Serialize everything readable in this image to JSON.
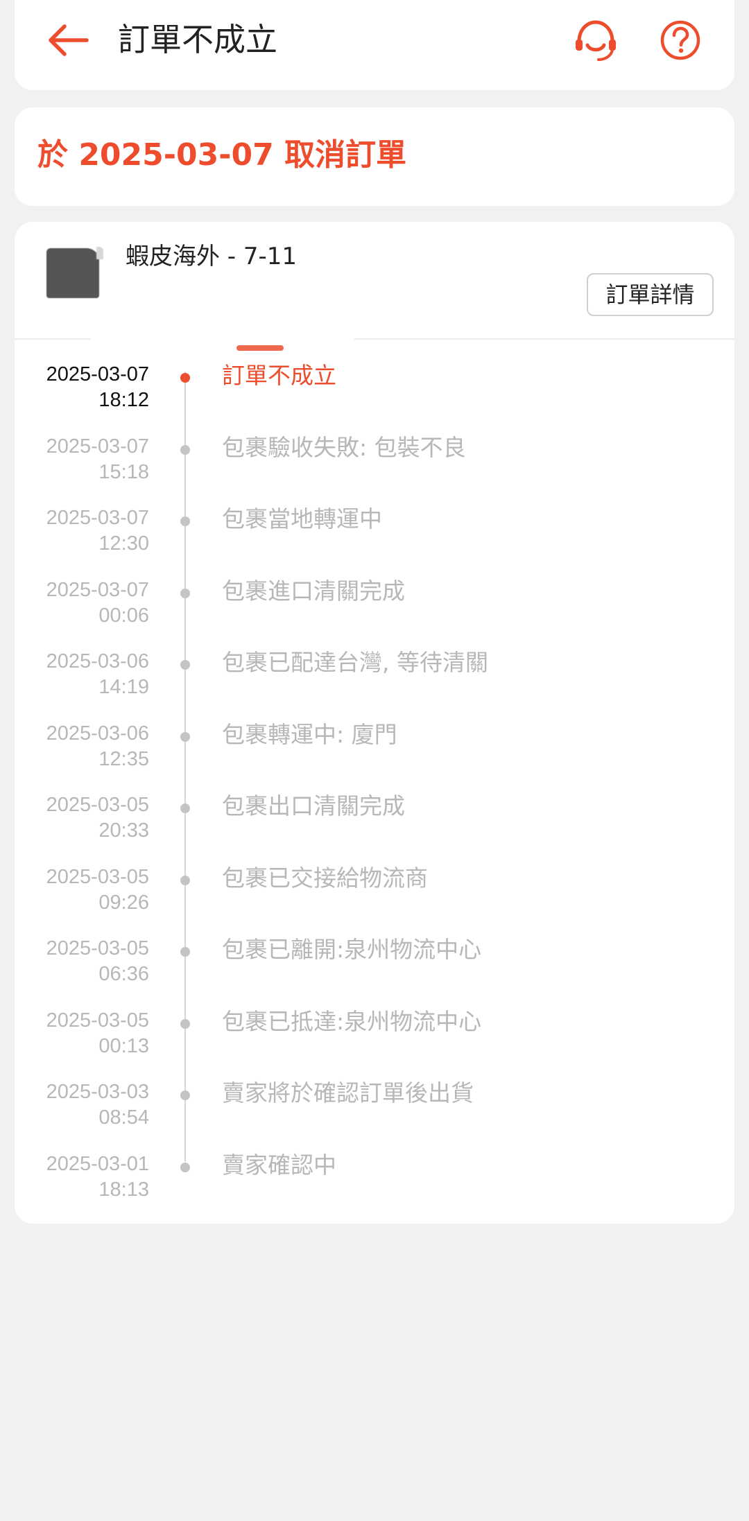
{
  "header": {
    "title": "訂單不成立",
    "back_icon": "back-arrow-icon",
    "support_icon": "headset-icon",
    "help_icon": "question-icon"
  },
  "banner": {
    "text": "於 2025-03-07 取消訂單"
  },
  "shipment": {
    "shop": "蝦皮海外 - 7-11",
    "details_button": "訂單詳情",
    "events": [
      {
        "date": "2025-03-07",
        "time": "18:12",
        "text": "訂單不成立",
        "active": true
      },
      {
        "date": "2025-03-07",
        "time": "15:18",
        "text": "包裹驗收失敗: 包裝不良"
      },
      {
        "date": "2025-03-07",
        "time": "12:30",
        "text": "包裹當地轉運中"
      },
      {
        "date": "2025-03-07",
        "time": "00:06",
        "text": "包裹進口清關完成"
      },
      {
        "date": "2025-03-06",
        "time": "14:19",
        "text": "包裹已配達台灣, 等待清關"
      },
      {
        "date": "2025-03-06",
        "time": "12:35",
        "text": "包裹轉運中: 廈門"
      },
      {
        "date": "2025-03-05",
        "time": "20:33",
        "text": "包裹出口清關完成"
      },
      {
        "date": "2025-03-05",
        "time": "09:26",
        "text": "包裹已交接給物流商"
      },
      {
        "date": "2025-03-05",
        "time": "06:36",
        "text": "包裹已離開:泉州物流中心"
      },
      {
        "date": "2025-03-05",
        "time": "00:13",
        "text": "包裹已抵達:泉州物流中心"
      },
      {
        "date": "2025-03-03",
        "time": "08:54",
        "text": "賣家將於確認訂單後出貨"
      },
      {
        "date": "2025-03-01",
        "time": "18:13",
        "text": "賣家確認中"
      }
    ]
  },
  "colors": {
    "accent": "#ee4d2d",
    "muted": "#b7b7b7",
    "background": "#f1f1f1"
  }
}
